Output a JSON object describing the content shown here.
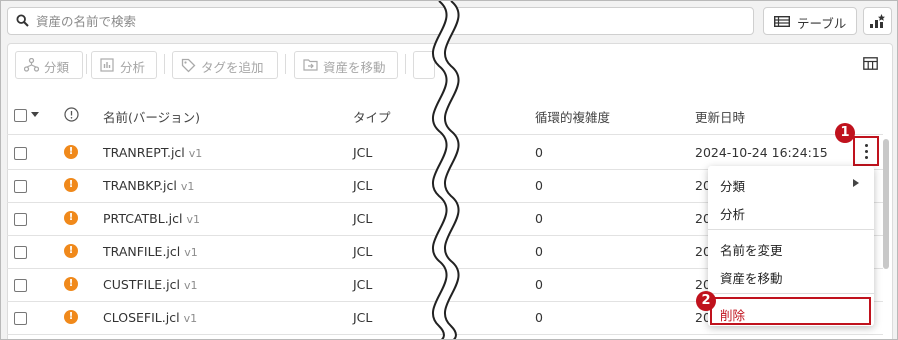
{
  "search": {
    "placeholder": "資産の名前で検索"
  },
  "view_toggle": {
    "label": "テーブル"
  },
  "toolbar": {
    "categorize": "分類",
    "analyze": "分析",
    "add_tag": "タグを追加",
    "move_asset": "資産を移動"
  },
  "table": {
    "columns": {
      "name": "名前(バージョン)",
      "type": "タイプ",
      "complexity": "循環的複雑度",
      "updated": "更新日時"
    },
    "warning_glyph": "!",
    "rows": [
      {
        "name": "TRANREPT.jcl",
        "version": "v1",
        "type": "JCL",
        "complexity": "0",
        "updated": "2024-10-24 16:24:15"
      },
      {
        "name": "TRANBKP.jcl",
        "version": "v1",
        "type": "JCL",
        "complexity": "0",
        "updated": "20"
      },
      {
        "name": "PRTCATBL.jcl",
        "version": "v1",
        "type": "JCL",
        "complexity": "0",
        "updated": "20"
      },
      {
        "name": "TRANFILE.jcl",
        "version": "v1",
        "type": "JCL",
        "complexity": "0",
        "updated": "20"
      },
      {
        "name": "CUSTFILE.jcl",
        "version": "v1",
        "type": "JCL",
        "complexity": "0",
        "updated": "20"
      },
      {
        "name": "CLOSEFIL.jcl",
        "version": "v1",
        "type": "JCL",
        "complexity": "0",
        "updated": "20"
      }
    ]
  },
  "context_menu": {
    "categorize": "分類",
    "analyze": "分析",
    "rename": "名前を変更",
    "move": "資産を移動",
    "delete": "削除"
  },
  "callouts": {
    "first": "1",
    "second": "2"
  },
  "colors": {
    "accent": "#c0121d",
    "warning": "#f0891b",
    "delete_text": "#c0121d"
  }
}
